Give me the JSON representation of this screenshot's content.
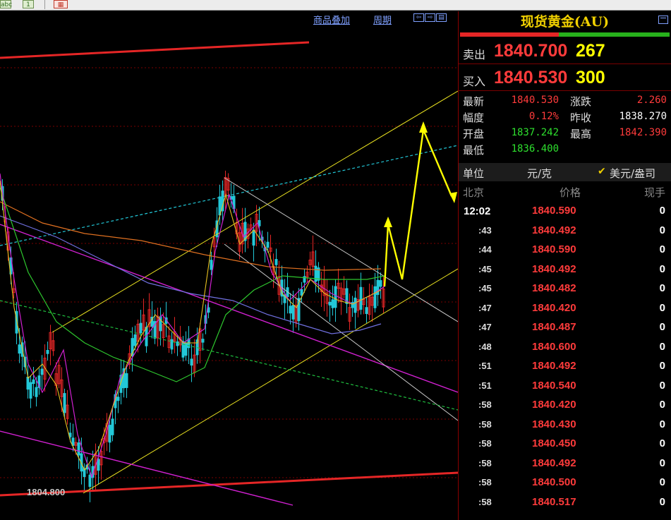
{
  "toolbar": {
    "btn1": "abc",
    "btn2": "1",
    "btn3": ""
  },
  "chart_header": {
    "overlay_label": "商品叠加",
    "period_label": "周期"
  },
  "chart_data": {
    "type": "candlestick",
    "annotations": [
      {
        "text": "1804.800",
        "note": "low price label"
      }
    ],
    "grid": "dotted red horizontal",
    "overlay_lines": [
      "yellow channel",
      "magenta trendlines",
      "white descending channel",
      "cyan dashed",
      "green dashed",
      "red long-term line"
    ]
  },
  "quote": {
    "title": "现货黄金(AU)",
    "sell_label": "卖出",
    "sell_price": "1840.700",
    "sell_volume": "267",
    "buy_label": "买入",
    "buy_price": "1840.530",
    "buy_volume": "300",
    "stats": [
      {
        "label": "最新",
        "value": "1840.530",
        "color": "#ff3b3b"
      },
      {
        "label": "涨跌",
        "value": "2.260",
        "color": "#ff3b3b"
      },
      {
        "label": "幅度",
        "value": "0.12%",
        "color": "#ff3b3b"
      },
      {
        "label": "昨收",
        "value": "1838.270",
        "color": "#ffffff"
      },
      {
        "label": "开盘",
        "value": "1837.242",
        "color": "#2ee02e"
      },
      {
        "label": "最高",
        "value": "1842.390",
        "color": "#ff3b3b"
      },
      {
        "label": "最低",
        "value": "1836.400",
        "color": "#2ee02e"
      }
    ],
    "unit_label": "单位",
    "unit_option1": "元/克",
    "unit_option2": "美元/盎司",
    "unit_selected": "美元/盎司",
    "ticks_head": {
      "time": "北京",
      "price": "价格",
      "volume": "现手"
    },
    "ticks": [
      {
        "t": "12:02",
        "p": "1840.590",
        "v": "0"
      },
      {
        "t": ":43",
        "p": "1840.492",
        "v": "0"
      },
      {
        "t": ":44",
        "p": "1840.590",
        "v": "0"
      },
      {
        "t": ":45",
        "p": "1840.492",
        "v": "0"
      },
      {
        "t": ":45",
        "p": "1840.482",
        "v": "0"
      },
      {
        "t": ":47",
        "p": "1840.420",
        "v": "0"
      },
      {
        "t": ":47",
        "p": "1840.487",
        "v": "0"
      },
      {
        "t": ":48",
        "p": "1840.600",
        "v": "0"
      },
      {
        "t": ":51",
        "p": "1840.492",
        "v": "0"
      },
      {
        "t": ":51",
        "p": "1840.540",
        "v": "0"
      },
      {
        "t": ":58",
        "p": "1840.420",
        "v": "0"
      },
      {
        "t": ":58",
        "p": "1840.430",
        "v": "0"
      },
      {
        "t": ":58",
        "p": "1840.450",
        "v": "0"
      },
      {
        "t": ":58",
        "p": "1840.492",
        "v": "0"
      },
      {
        "t": ":58",
        "p": "1840.500",
        "v": "0"
      },
      {
        "t": ":58",
        "p": "1840.517",
        "v": "0"
      }
    ]
  }
}
